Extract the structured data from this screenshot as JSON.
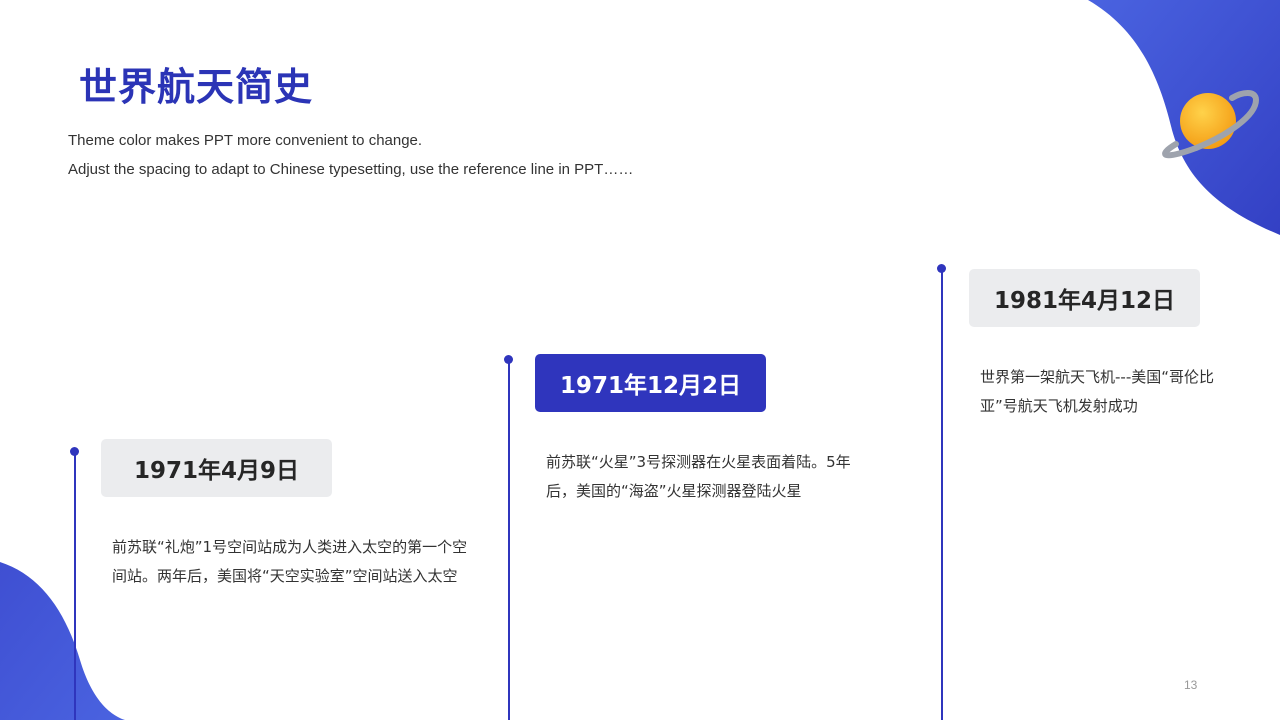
{
  "slide": {
    "title": "世界航天简史",
    "subtitle_lines": [
      "Theme color makes PPT more convenient to change.",
      "Adjust the spacing to adapt to Chinese typesetting, use the reference line in PPT……"
    ],
    "page_number": "13"
  },
  "timeline": [
    {
      "date": "1971年4月9日",
      "style": "gray",
      "description": "前苏联“礼炮”1号空间站成为人类进入太空的第一个空间站。两年后，美国将“天空实验室”空间站送入太空"
    },
    {
      "date": "1971年12月2日",
      "style": "blue",
      "description": "前苏联“火星”3号探测器在火星表面着陆。5年后，美国的“海盗”火星探测器登陆火星"
    },
    {
      "date": "1981年4月12日",
      "style": "gray",
      "description": "世界第一架航天飞机---美国“哥伦比亚”号航天飞机发射成功"
    }
  ],
  "colors": {
    "accent": "#2f35bd",
    "title": "#2b34b6",
    "date_box_gray": "#ebecee",
    "planet_orange": "#f7a11a",
    "planet_ring": "#9ea3ad"
  },
  "icons": {
    "decoration": "planet-icon"
  }
}
